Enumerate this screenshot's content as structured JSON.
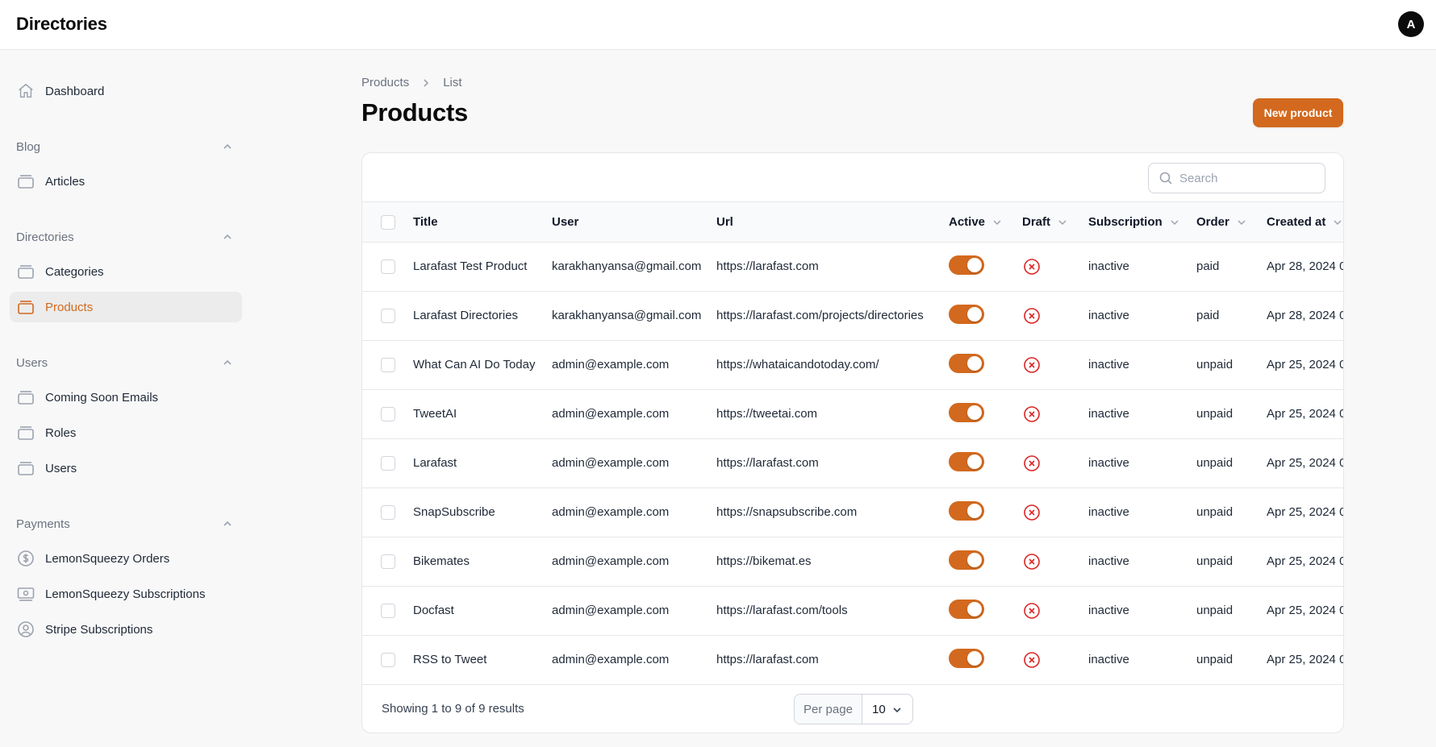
{
  "app": {
    "brand": "Directories",
    "avatar_initial": "A"
  },
  "colors": {
    "accent": "#d2691e",
    "draft_icon": "#dc2626"
  },
  "sidebar": {
    "dashboard": {
      "label": "Dashboard",
      "icon": "home-icon"
    },
    "groups": [
      {
        "label": "Blog",
        "items": [
          {
            "label": "Articles",
            "icon": "stack-icon"
          }
        ]
      },
      {
        "label": "Directories",
        "items": [
          {
            "label": "Categories",
            "icon": "stack-icon"
          },
          {
            "label": "Products",
            "icon": "stack-icon",
            "active": true
          }
        ]
      },
      {
        "label": "Users",
        "items": [
          {
            "label": "Coming Soon Emails",
            "icon": "stack-icon"
          },
          {
            "label": "Roles",
            "icon": "stack-icon"
          },
          {
            "label": "Users",
            "icon": "stack-icon"
          }
        ]
      },
      {
        "label": "Payments",
        "items": [
          {
            "label": "LemonSqueezy Orders",
            "icon": "dollar-circle-icon"
          },
          {
            "label": "LemonSqueezy Subscriptions",
            "icon": "banknote-icon"
          },
          {
            "label": "Stripe Subscriptions",
            "icon": "user-circle-icon"
          }
        ]
      }
    ]
  },
  "breadcrumb": {
    "parent": "Products",
    "current": "List"
  },
  "page": {
    "title": "Products",
    "new_button": "New product"
  },
  "search": {
    "placeholder": "Search"
  },
  "table": {
    "columns": {
      "title": "Title",
      "user": "User",
      "url": "Url",
      "active": "Active",
      "draft": "Draft",
      "subscription": "Subscription",
      "order": "Order",
      "created_at": "Created at"
    },
    "rows": [
      {
        "title": "Larafast Test Product",
        "user": "karakhanyansa@gmail.com",
        "url": "https://larafast.com",
        "active": true,
        "draft": false,
        "subscription": "inactive",
        "order": "paid",
        "created_at": "Apr 28, 2024 0"
      },
      {
        "title": "Larafast Directories",
        "user": "karakhanyansa@gmail.com",
        "url": "https://larafast.com/projects/directories",
        "active": true,
        "draft": false,
        "subscription": "inactive",
        "order": "paid",
        "created_at": "Apr 28, 2024 0"
      },
      {
        "title": "What Can AI Do Today",
        "user": "admin@example.com",
        "url": "https://whataicandotoday.com/",
        "active": true,
        "draft": false,
        "subscription": "inactive",
        "order": "unpaid",
        "created_at": "Apr 25, 2024 0"
      },
      {
        "title": "TweetAI",
        "user": "admin@example.com",
        "url": "https://tweetai.com",
        "active": true,
        "draft": false,
        "subscription": "inactive",
        "order": "unpaid",
        "created_at": "Apr 25, 2024 0"
      },
      {
        "title": "Larafast",
        "user": "admin@example.com",
        "url": "https://larafast.com",
        "active": true,
        "draft": false,
        "subscription": "inactive",
        "order": "unpaid",
        "created_at": "Apr 25, 2024 0"
      },
      {
        "title": "SnapSubscribe",
        "user": "admin@example.com",
        "url": "https://snapsubscribe.com",
        "active": true,
        "draft": false,
        "subscription": "inactive",
        "order": "unpaid",
        "created_at": "Apr 25, 2024 0"
      },
      {
        "title": "Bikemates",
        "user": "admin@example.com",
        "url": "https://bikemat.es",
        "active": true,
        "draft": false,
        "subscription": "inactive",
        "order": "unpaid",
        "created_at": "Apr 25, 2024 0"
      },
      {
        "title": "Docfast",
        "user": "admin@example.com",
        "url": "https://larafast.com/tools",
        "active": true,
        "draft": false,
        "subscription": "inactive",
        "order": "unpaid",
        "created_at": "Apr 25, 2024 0"
      },
      {
        "title": "RSS to Tweet",
        "user": "admin@example.com",
        "url": "https://larafast.com",
        "active": true,
        "draft": false,
        "subscription": "inactive",
        "order": "unpaid",
        "created_at": "Apr 25, 2024 0"
      }
    ]
  },
  "footer": {
    "showing": "Showing 1 to 9 of 9 results",
    "per_page_label": "Per page",
    "per_page_value": "10"
  }
}
